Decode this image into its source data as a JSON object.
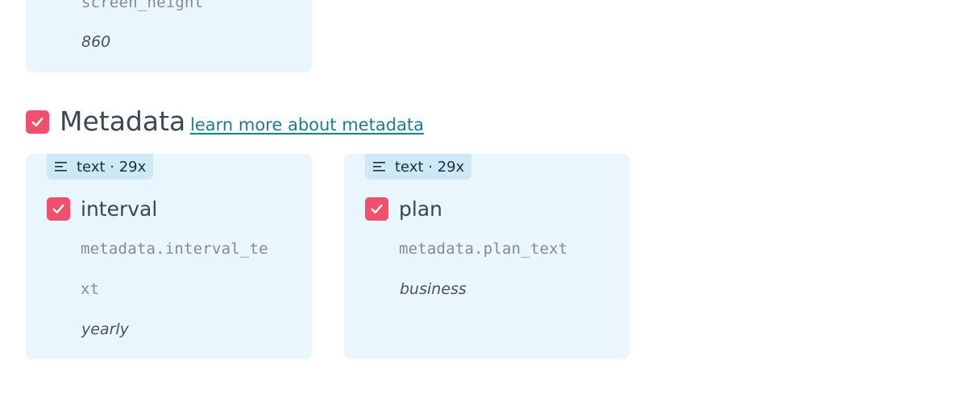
{
  "top_card": {
    "field_path": "screen_height",
    "sample_value": "860"
  },
  "metadata_section": {
    "checked": true,
    "title": "Metadata",
    "link_text": "learn more about metadata"
  },
  "fields": [
    {
      "badge": "text · 29x",
      "badge_icon": "lines-icon",
      "checked": true,
      "name": "interval",
      "path_line1": "metadata.interval_te",
      "path_line2": "xt",
      "sample_value": "yearly"
    },
    {
      "badge": "text · 29x",
      "badge_icon": "lines-icon",
      "checked": true,
      "name": "plan",
      "path_line1": "metadata.plan_text",
      "sample_value": "business"
    }
  ],
  "colors": {
    "card_bg": "#eaf6fd",
    "badge_bg": "#cde9f8",
    "checkbox": "#f0506e",
    "link": "#1b7f84"
  }
}
